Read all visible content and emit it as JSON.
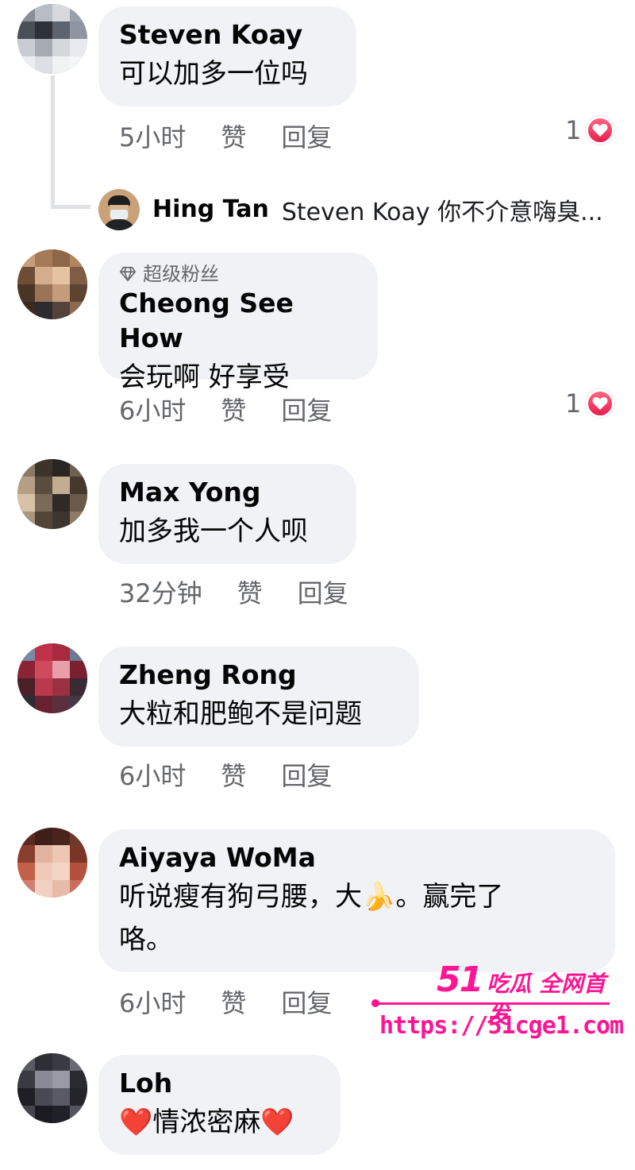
{
  "comments": [
    {
      "name": "Steven Koay",
      "text": [
        "可以加多一位吗"
      ],
      "actions": {
        "time": "5小时",
        "like": "赞",
        "reply": "回复"
      },
      "reaction_count": "1",
      "reply_preview": {
        "name": "Hing Tan",
        "text": "Steven Koay 你不介意嗨臭..."
      }
    },
    {
      "badge": "超级粉丝",
      "name": "Cheong See How",
      "text": [
        "会玩啊 好享受"
      ],
      "actions": {
        "time": "6小时",
        "like": "赞",
        "reply": "回复"
      },
      "reaction_count": "1"
    },
    {
      "name": "Max Yong",
      "text": [
        "加多我一个人呗"
      ],
      "actions": {
        "time": "32分钟",
        "like": "赞",
        "reply": "回复"
      }
    },
    {
      "name": "Zheng Rong",
      "text": [
        "大粒和肥鲍不是问题"
      ],
      "actions": {
        "time": "6小时",
        "like": "赞",
        "reply": "回复"
      }
    },
    {
      "name": "Aiyaya WoMa",
      "text": [
        "听说瘦有狗弓腰，大🍌。赢完了",
        "咯。"
      ],
      "actions": {
        "time": "6小时",
        "like": "赞",
        "reply": "回复"
      }
    },
    {
      "name": "Loh",
      "text": [
        "❤️情浓密麻❤️"
      ]
    }
  ],
  "watermark": {
    "number": "51",
    "label": "吃瓜 全网首发",
    "url": "https://51cge1.com"
  },
  "colors": {
    "bubble": "#f0f2f5",
    "secondary_text": "#65676b",
    "heart": "#e61e4d",
    "watermark": "#ff1493"
  },
  "icons": [
    "diamond-icon",
    "heart-reaction-icon"
  ]
}
